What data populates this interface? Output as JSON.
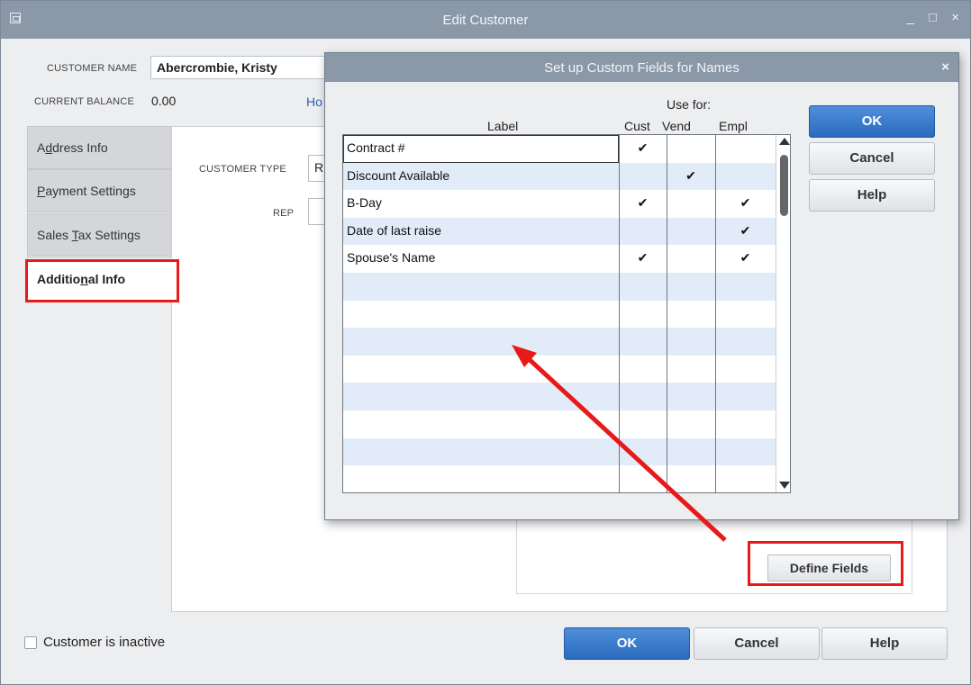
{
  "main_window": {
    "title": "Edit Customer",
    "window_controls": "_ □ ×",
    "customer_name_label": "CUSTOMER NAME",
    "customer_name_value": "Abercrombie, Kristy",
    "current_balance_label": "CURRENT BALANCE",
    "current_balance_value": "0.00",
    "how_link_text": "Ho",
    "tabs": [
      {
        "pre": "A",
        "accel": "d",
        "post": "dress Info"
      },
      {
        "pre": "",
        "accel": "P",
        "post": "ayment Settings"
      },
      {
        "pre": "Sales ",
        "accel": "T",
        "post": "ax Settings"
      },
      {
        "pre": "Additio",
        "accel": "n",
        "post": "al Info"
      }
    ],
    "customer_type_label": "CUSTOMER TYPE",
    "customer_type_value": "R",
    "rep_label": "REP",
    "define_fields_label": "Define Fields",
    "inactive_label": "Customer is inactive",
    "ok_label": "OK",
    "cancel_label": "Cancel",
    "help_label": "Help"
  },
  "dialog": {
    "title": "Set up Custom Fields for Names",
    "close_glyph": "×",
    "use_for_label": "Use for:",
    "columns": {
      "label": "Label",
      "cust": "Cust",
      "vend": "Vend",
      "empl": "Empl"
    },
    "rows": [
      {
        "label": "Contract #",
        "cust": "✔",
        "vend": "",
        "empl": ""
      },
      {
        "label": "Discount Available",
        "cust": "",
        "vend": "✔",
        "empl": ""
      },
      {
        "label": "B-Day",
        "cust": "✔",
        "vend": "",
        "empl": "✔"
      },
      {
        "label": "Date of last raise",
        "cust": "",
        "vend": "",
        "empl": "✔"
      },
      {
        "label": "Spouse's Name",
        "cust": "✔",
        "vend": "",
        "empl": "✔"
      },
      {
        "label": "",
        "cust": "",
        "vend": "",
        "empl": ""
      },
      {
        "label": "",
        "cust": "",
        "vend": "",
        "empl": ""
      },
      {
        "label": "",
        "cust": "",
        "vend": "",
        "empl": ""
      },
      {
        "label": "",
        "cust": "",
        "vend": "",
        "empl": ""
      },
      {
        "label": "",
        "cust": "",
        "vend": "",
        "empl": ""
      },
      {
        "label": "",
        "cust": "",
        "vend": "",
        "empl": ""
      },
      {
        "label": "",
        "cust": "",
        "vend": "",
        "empl": ""
      },
      {
        "label": "",
        "cust": "",
        "vend": "",
        "empl": ""
      }
    ],
    "ok_label": "OK",
    "cancel_label": "Cancel",
    "help_label": "Help"
  },
  "annotation_color": "#e81919",
  "accent_color": "#2a6bc0"
}
